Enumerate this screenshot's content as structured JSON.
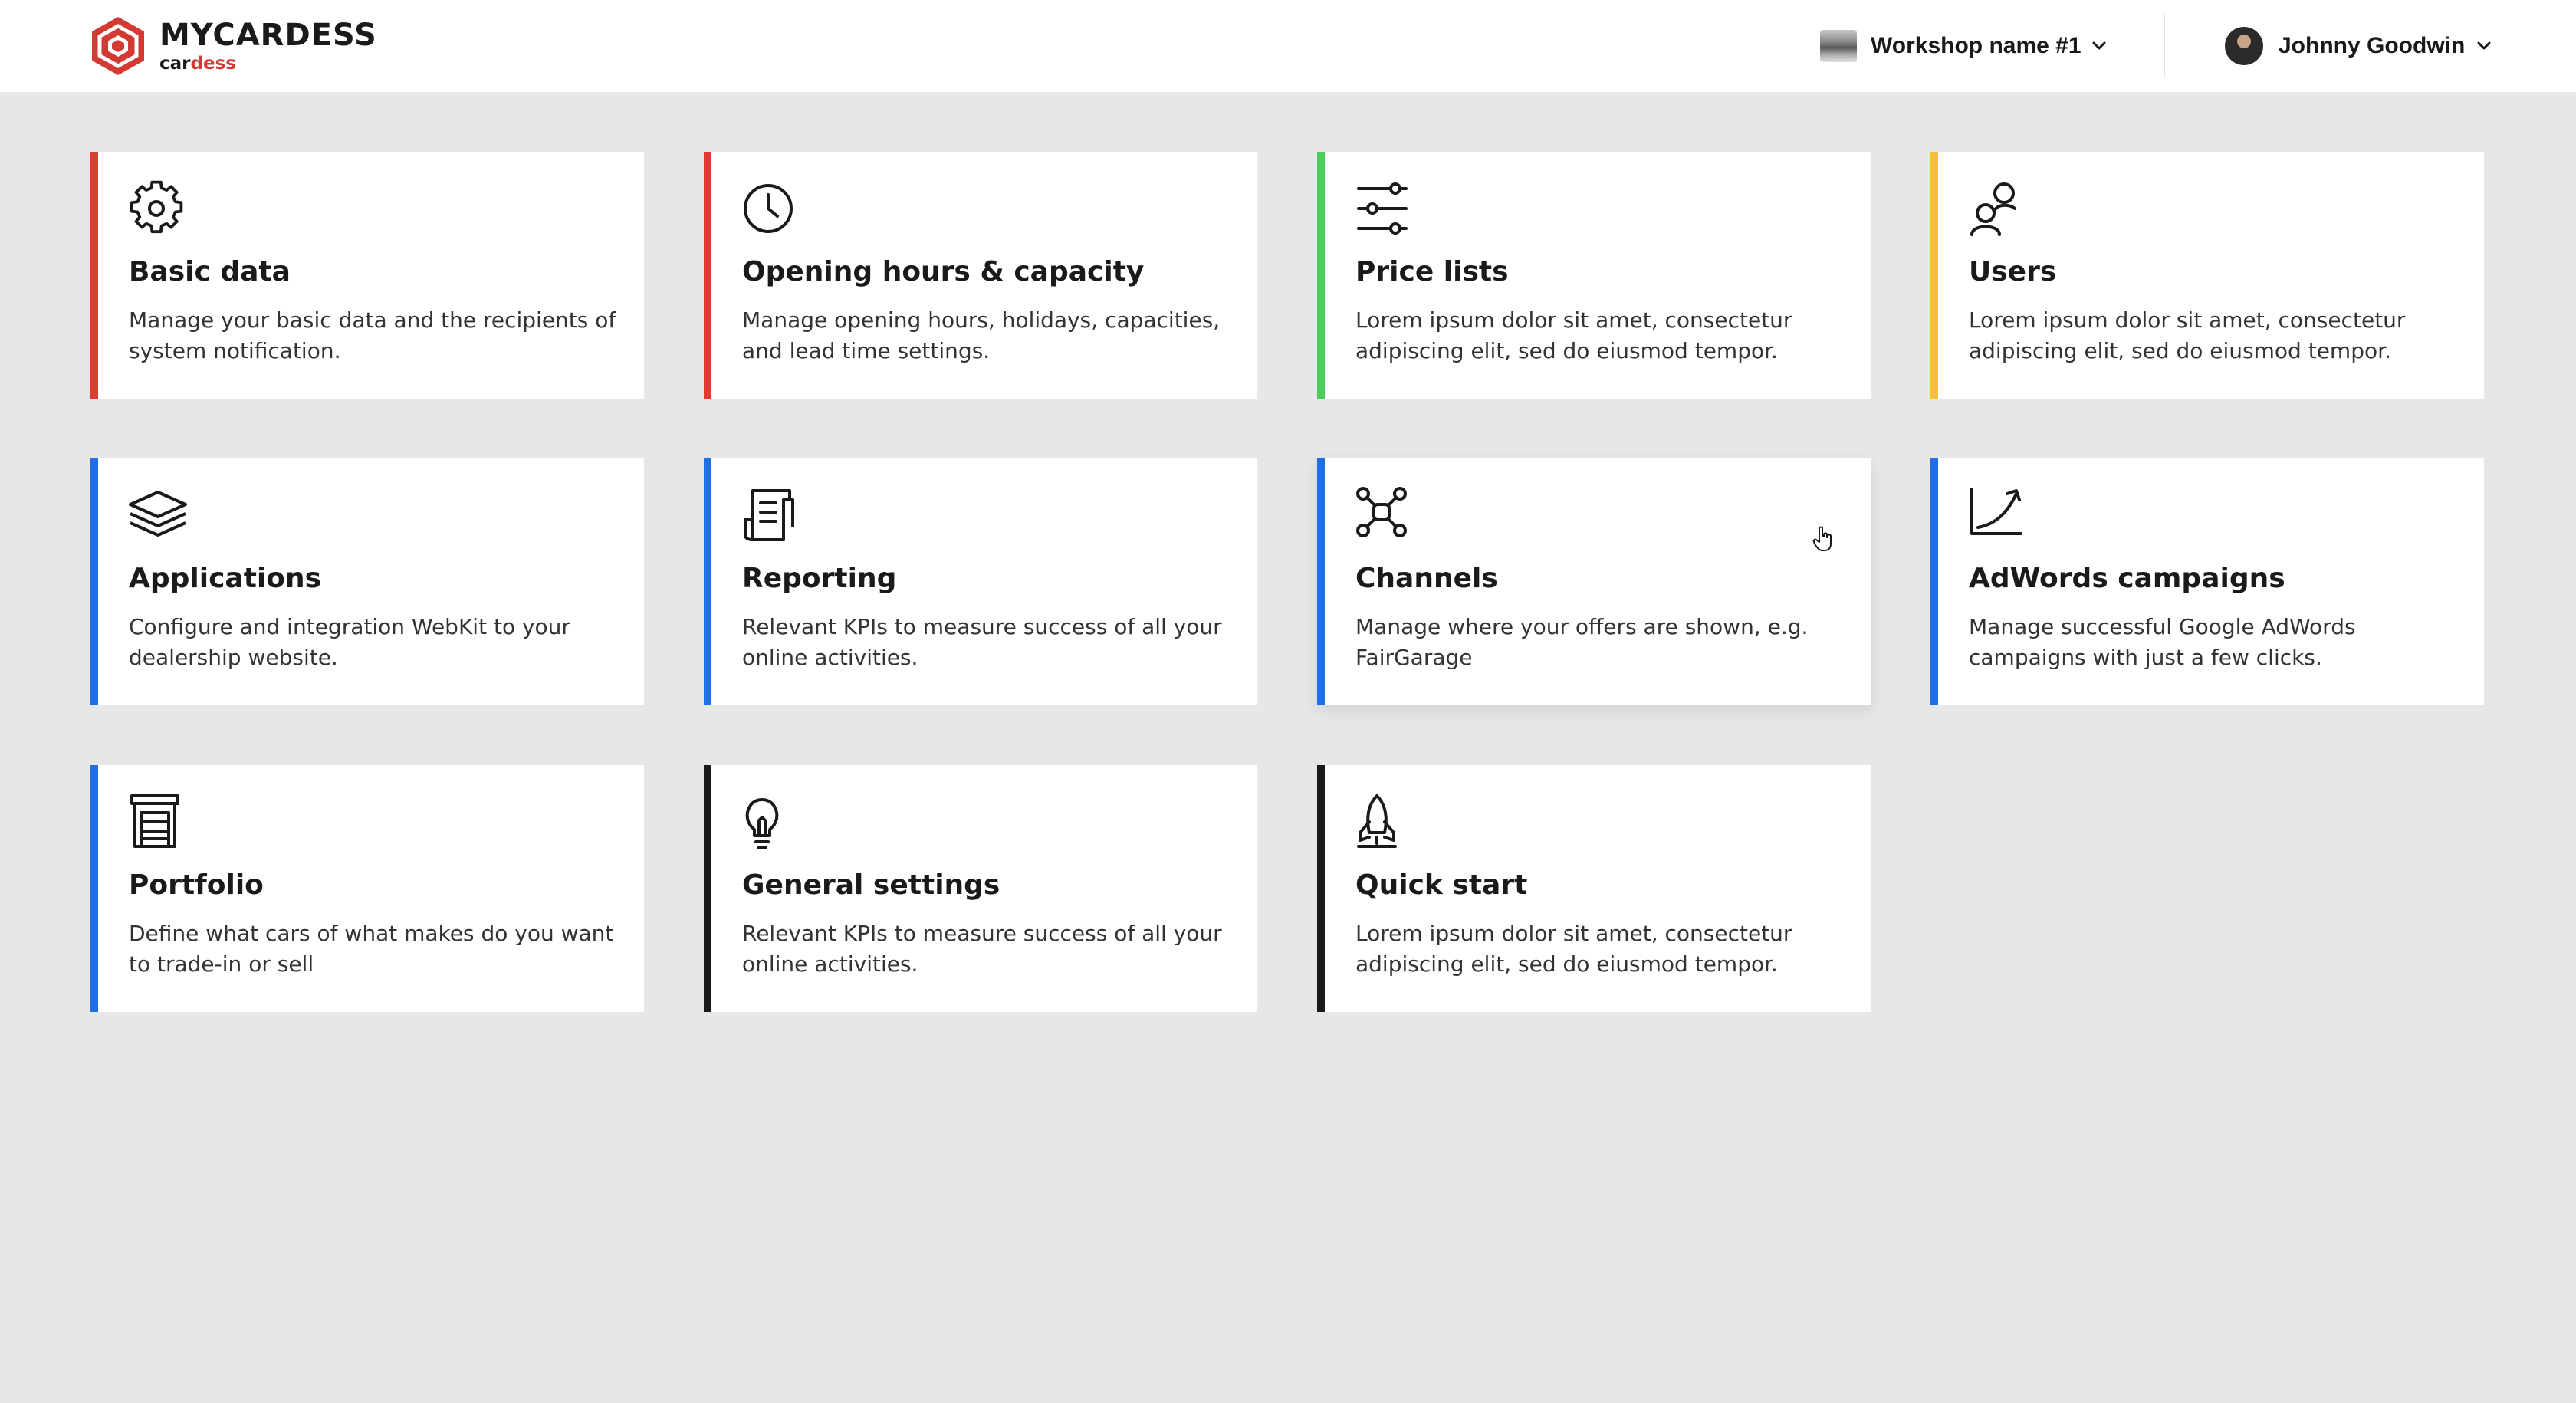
{
  "header": {
    "brand_title": "MYCARDESS",
    "brand_sub_before": "car",
    "brand_sub_accent": "dess",
    "workshop_label": "Workshop name #1",
    "user_name": "Johnny Goodwin"
  },
  "colors": {
    "red": "#e03b33",
    "green": "#4ccc5a",
    "yellow": "#f5c42c",
    "blue": "#1f6fe5",
    "black": "#1a1a1a",
    "brand_red": "#d23a33"
  },
  "cards": [
    {
      "title": "Basic data",
      "desc": "Manage your basic data and the recipients of system notification.",
      "accent": "red",
      "icon": "gear-icon"
    },
    {
      "title": "Opening hours & capacity",
      "desc": "Manage opening hours, holidays, capacities, and lead time settings.",
      "accent": "red",
      "icon": "clock-icon"
    },
    {
      "title": "Price lists",
      "desc": "Lorem ipsum dolor sit amet, consectetur adipiscing elit, sed do eiusmod tempor.",
      "accent": "green",
      "icon": "sliders-icon"
    },
    {
      "title": "Users",
      "desc": "Lorem ipsum dolor sit amet, consectetur adipiscing elit, sed do eiusmod tempor.",
      "accent": "yellow",
      "icon": "users-icon"
    },
    {
      "title": "Applications",
      "desc": "Configure and integration WebKit to your dealership website.",
      "accent": "blue",
      "icon": "layers-icon"
    },
    {
      "title": "Reporting",
      "desc": "Relevant KPIs to measure success of all your online activities.",
      "accent": "blue",
      "icon": "report-icon"
    },
    {
      "title": "Channels",
      "desc": "Manage where your offers are shown, e.g. FairGarage",
      "accent": "blue",
      "icon": "network-icon"
    },
    {
      "title": "AdWords campaigns",
      "desc": "Manage successful Google AdWords campaigns with just a few clicks.",
      "accent": "blue",
      "icon": "growth-chart-icon"
    },
    {
      "title": "Portfolio",
      "desc": "Define what cars of what makes do you want to trade-in or sell",
      "accent": "blue",
      "icon": "garage-icon"
    },
    {
      "title": "General settings",
      "desc": "Relevant KPIs to measure success of all your online activities.",
      "accent": "black",
      "icon": "lightbulb-icon"
    },
    {
      "title": "Quick start",
      "desc": "Lorem ipsum dolor sit amet, consectetur adipiscing elit, sed do eiusmod tempor.",
      "accent": "black",
      "icon": "rocket-icon"
    }
  ]
}
